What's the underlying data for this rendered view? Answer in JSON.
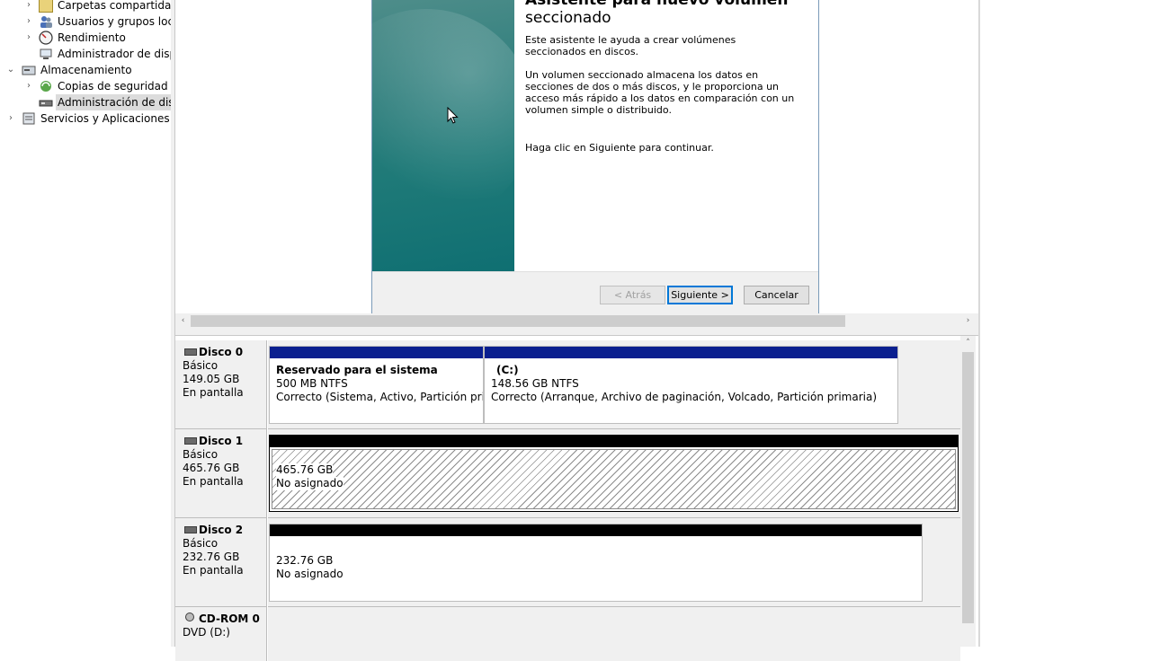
{
  "tree": {
    "items": [
      {
        "label": "Carpetas compartidas",
        "icon": "shared-folder-icon",
        "expand": "›"
      },
      {
        "label": "Usuarios y grupos locales",
        "icon": "users-groups-icon",
        "expand": "›"
      },
      {
        "label": "Rendimiento",
        "icon": "performance-icon",
        "expand": "›"
      },
      {
        "label": "Administrador de dispositivos",
        "icon": "device-manager-icon",
        "expand": ""
      },
      {
        "label": "Almacenamiento",
        "icon": "storage-icon",
        "expand": "⌄"
      },
      {
        "label": "Copias de seguridad de Windows Server",
        "icon": "backup-icon",
        "expand": "›"
      },
      {
        "label": "Administración de discos",
        "icon": "disk-management-icon",
        "expand": ""
      },
      {
        "label": "Servicios y Aplicaciones",
        "icon": "services-icon",
        "expand": "›"
      }
    ]
  },
  "wizard": {
    "title_line1": "Asistente para nuevo volumen",
    "title_line2": "seccionado",
    "intro": "Este asistente le ayuda a crear volúmenes seccionados en discos.",
    "description": "Un volumen seccionado almacena los datos en secciones de dos o más discos, y le proporciona un acceso más rápido a los datos en comparación con un volumen simple o distribuido.",
    "continue_hint": "Haga clic en Siguiente para continuar.",
    "back_label": "< Atrás",
    "next_label": "Siguiente >",
    "cancel_label": "Cancelar"
  },
  "disks": [
    {
      "name": "Disco 0",
      "type": "Básico",
      "size": "149.05 GB",
      "status": "En pantalla",
      "partitions": [
        {
          "name": "Reservado para el sistema",
          "size": "500 MB NTFS",
          "status": "Correcto (Sistema, Activo, Partición primaria)",
          "bar_color": "#0a1f8f"
        },
        {
          "name": "(C:)",
          "size": "148.56 GB NTFS",
          "status": "Correcto (Arranque, Archivo de paginación, Volcado, Partición primaria)",
          "bar_color": "#0a1f8f"
        }
      ]
    },
    {
      "name": "Disco 1",
      "type": "Básico",
      "size": "465.76 GB",
      "status": "En pantalla",
      "partitions": [
        {
          "name": "",
          "size": "465.76 GB",
          "status": "No asignado",
          "bar_color": "#000000"
        }
      ]
    },
    {
      "name": "Disco 2",
      "type": "Básico",
      "size": "232.76 GB",
      "status": "En pantalla",
      "partitions": [
        {
          "name": "",
          "size": "232.76 GB",
          "status": "No asignado",
          "bar_color": "#000000"
        }
      ]
    },
    {
      "name": "CD-ROM 0",
      "type": "DVD (D:)"
    }
  ],
  "scrollbars": {
    "left_arrow": "‹",
    "right_arrow": "›",
    "up_arrow": "˄"
  }
}
